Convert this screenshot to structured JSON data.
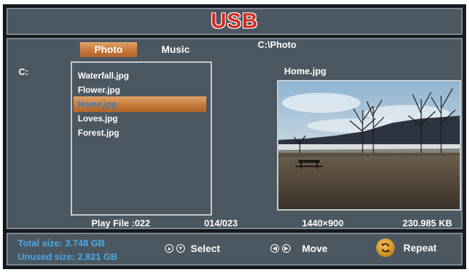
{
  "header": {
    "logo_text": "USB"
  },
  "tabs": [
    {
      "label": "Photo",
      "active": true
    },
    {
      "label": "Music",
      "active": false
    }
  ],
  "path": "C:\\Photo",
  "drive": "C:",
  "files": [
    {
      "name": "Waterfall.jpg",
      "selected": false
    },
    {
      "name": "Flower.jpg",
      "selected": false
    },
    {
      "name": "Home.jpg",
      "selected": true
    },
    {
      "name": "Loves.jpg",
      "selected": false
    },
    {
      "name": "Forest.jpg",
      "selected": false
    }
  ],
  "preview": {
    "title": "Home.jpg"
  },
  "info": {
    "play_file": "Play File  :022",
    "index": "014/023",
    "resolution": "1440×900",
    "filesize": "230.985 KB"
  },
  "footer": {
    "total_size": "Total size: 3.748 GB",
    "unused_size": "Unused size: 2.821 GB",
    "select_label": "Select",
    "move_label": "Move",
    "repeat_label": "Repeat"
  },
  "colors": {
    "accent_orange": "#c57a3c",
    "logo_red": "#d62a1f",
    "size_blue": "#4aa8e8",
    "panel": "#4b5761"
  },
  "icons": [
    "up-down-arrows-icon",
    "left-right-arrows-icon",
    "repeat-icon",
    "landscape-photo"
  ]
}
